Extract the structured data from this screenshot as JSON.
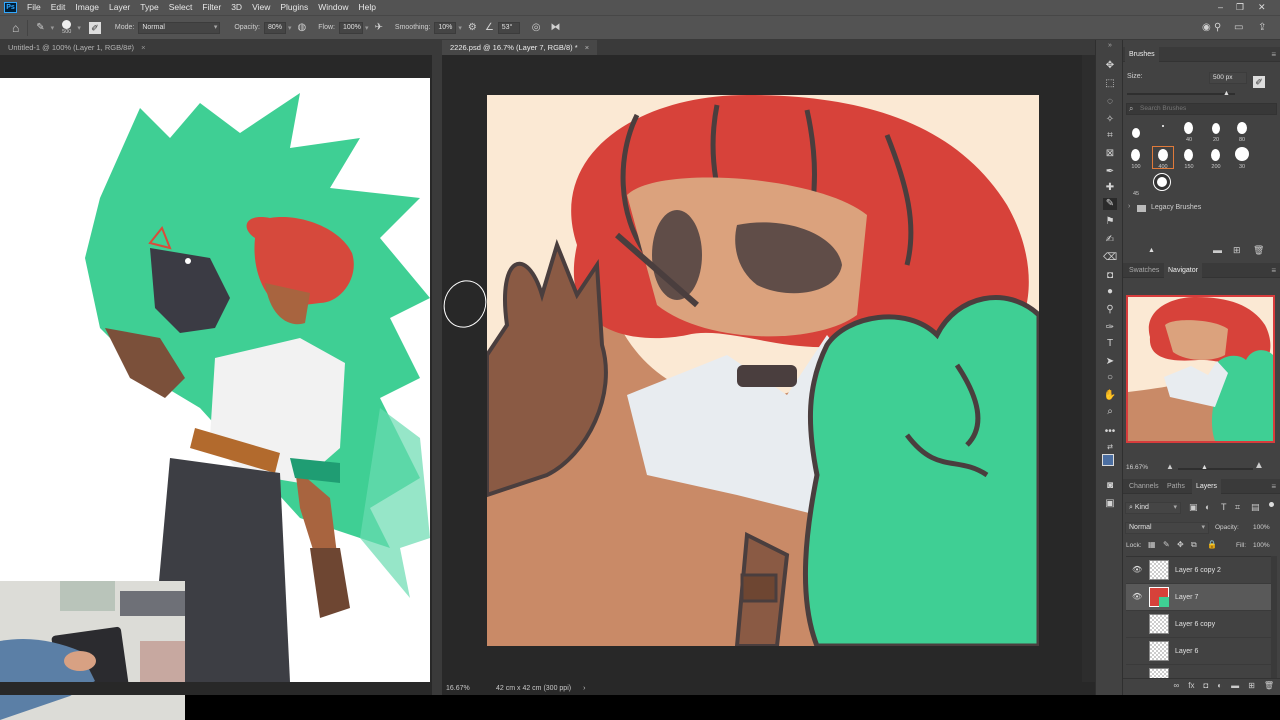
{
  "menubar": {
    "logo": "Ps",
    "items": [
      "File",
      "Edit",
      "Image",
      "Layer",
      "Type",
      "Select",
      "Filter",
      "3D",
      "View",
      "Plugins",
      "Window",
      "Help"
    ],
    "min": "–",
    "restore": "❐",
    "close": "✕"
  },
  "options": {
    "brush_size": "500",
    "mode_label": "Mode:",
    "mode_value": "Normal",
    "opacity_label": "Opacity:",
    "opacity_value": "80%",
    "flow_label": "Flow:",
    "flow_value": "100%",
    "smoothing_label": "Smoothing:",
    "smoothing_value": "10%",
    "angle_value": "53°"
  },
  "documents": {
    "tab1": "Untitled-1 @ 100% (Layer 1, RGB/8#)",
    "tab2": "2226.psd @ 16.7% (Layer 7, RGB/8) *",
    "close": "×",
    "zoom": "16.67%",
    "doc_info": "42 cm x 42 cm (300 ppi)",
    "status_arrow": "›"
  },
  "brushes": {
    "title": "Brushes",
    "size_label": "Size:",
    "size_value": "500 px",
    "search_placeholder": "Search Brushes",
    "labels": [
      "40",
      "20",
      "80",
      "100",
      "400",
      "150",
      "200",
      "30",
      "45"
    ],
    "folder": "Legacy Brushes"
  },
  "navigator": {
    "tab_swatches": "Swatches",
    "tab_navigator": "Navigator",
    "zoom": "16.67%"
  },
  "layers": {
    "tab_channels": "Channels",
    "tab_paths": "Paths",
    "tab_layers": "Layers",
    "filter_kind": "Kind",
    "blend_mode": "Normal",
    "opacity_label": "Opacity:",
    "opacity_value": "100%",
    "lock_label": "Lock:",
    "fill_label": "Fill:",
    "fill_value": "100%",
    "rows": [
      {
        "name": "Layer 6 copy 2",
        "visible": true,
        "selected": false
      },
      {
        "name": "Layer 7",
        "visible": true,
        "selected": true
      },
      {
        "name": "Layer 6 copy",
        "visible": false,
        "selected": false
      },
      {
        "name": "Layer 6",
        "visible": false,
        "selected": false
      }
    ]
  },
  "colors": {
    "panel_bg": "#424242",
    "canvas_bg": "#282828",
    "hair": "#d7423a",
    "creature": "#3fcf94",
    "skin": "#c98a67",
    "outline": "#4a3e3e"
  }
}
